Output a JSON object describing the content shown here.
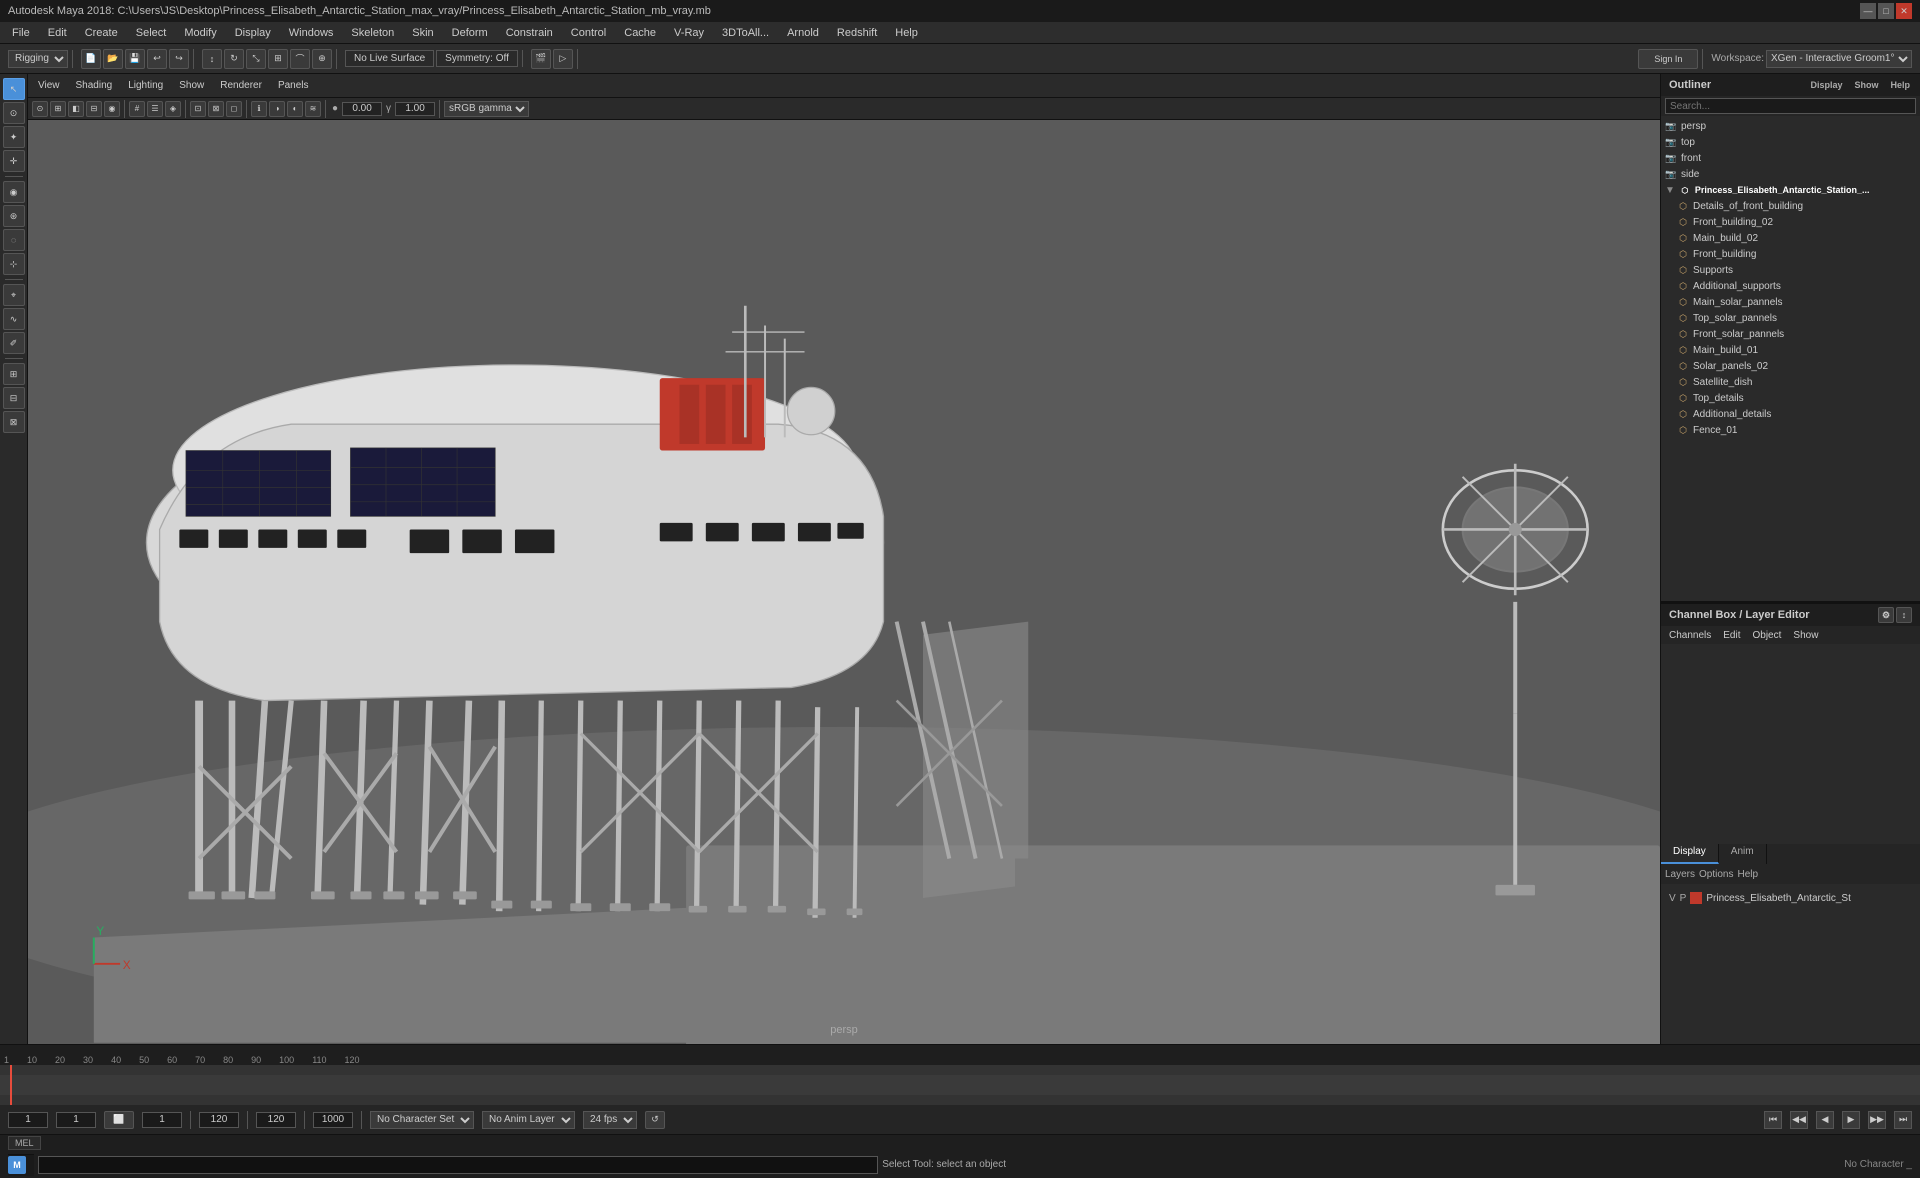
{
  "titlebar": {
    "title": "Autodesk Maya 2018: C:\\Users\\JS\\Desktop\\Princess_Elisabeth_Antarctic_Station_max_vray/Princess_Elisabeth_Antarctic_Station_mb_vray.mb",
    "controls": [
      "—",
      "□",
      "✕"
    ]
  },
  "menubar": {
    "items": [
      "File",
      "Edit",
      "Create",
      "Select",
      "Modify",
      "Display",
      "Windows",
      "Skeleton",
      "Skin",
      "Deform",
      "Constrain",
      "Control",
      "Cache",
      "V-Ray",
      "3DToAll...",
      "Arnold",
      "Redshift",
      "Help"
    ]
  },
  "toolbar": {
    "workspace_label": "Workspace:",
    "workspace_value": "XGen - Interactive Groom1°",
    "layout_dropdown": "Rigging",
    "no_live_surface": "No Live Surface",
    "symmetry": "Symmetry: Off",
    "sign_in": "Sign In"
  },
  "viewport": {
    "menus": [
      "View",
      "Shading",
      "Lighting",
      "Show",
      "Renderer",
      "Panels"
    ],
    "label": "persp",
    "gamma_label": "sRGB gamma",
    "gamma_value": "1.00",
    "color_value": "0.00"
  },
  "outliner": {
    "title": "Outliner",
    "menu_items": [
      "Display",
      "Show",
      "Help"
    ],
    "search_placeholder": "Search...",
    "items": [
      {
        "label": "persp",
        "type": "camera",
        "indent": 0
      },
      {
        "label": "top",
        "type": "camera",
        "indent": 0
      },
      {
        "label": "front",
        "type": "camera",
        "indent": 0
      },
      {
        "label": "side",
        "type": "camera",
        "indent": 0
      },
      {
        "label": "Princess_Elisabeth_Antarctic_Station_...",
        "type": "group",
        "indent": 0,
        "expanded": true
      },
      {
        "label": "Details_of_front_building",
        "type": "mesh",
        "indent": 1
      },
      {
        "label": "Front_building_02",
        "type": "mesh",
        "indent": 1
      },
      {
        "label": "Main_build_02",
        "type": "mesh",
        "indent": 1
      },
      {
        "label": "Front_building",
        "type": "mesh",
        "indent": 1
      },
      {
        "label": "Supports",
        "type": "mesh",
        "indent": 1
      },
      {
        "label": "Additional_supports",
        "type": "mesh",
        "indent": 1
      },
      {
        "label": "Main_solar_pannels",
        "type": "mesh",
        "indent": 1
      },
      {
        "label": "Top_solar_pannels",
        "type": "mesh",
        "indent": 1
      },
      {
        "label": "Front_solar_pannels",
        "type": "mesh",
        "indent": 1
      },
      {
        "label": "Main_build_01",
        "type": "mesh",
        "indent": 1
      },
      {
        "label": "Solar_panels_02",
        "type": "mesh",
        "indent": 1
      },
      {
        "label": "Satellite_dish",
        "type": "mesh",
        "indent": 1
      },
      {
        "label": "Top_details",
        "type": "mesh",
        "indent": 1
      },
      {
        "label": "Additional_details",
        "type": "mesh",
        "indent": 1
      },
      {
        "label": "Fence_01",
        "type": "mesh",
        "indent": 1
      }
    ]
  },
  "channel_box": {
    "title": "Channel Box / Layer Editor",
    "menu_items": [
      "Channels",
      "Edit",
      "Object",
      "Show"
    ]
  },
  "display_anim": {
    "tabs": [
      "Display",
      "Anim"
    ],
    "active_tab": "Display",
    "sub_items": [
      "Layers",
      "Options",
      "Help"
    ],
    "layer_name": "Princess_Elisabeth_Antarctic_St",
    "layer_color": "#c0392b"
  },
  "timeline": {
    "start": "1",
    "end": "120",
    "range_start": "1",
    "range_end": "120",
    "total_end": "1000",
    "fps": "24 fps",
    "ticks": [
      "1",
      "10",
      "20",
      "30",
      "40",
      "50",
      "60",
      "70",
      "80",
      "90",
      "100",
      "110",
      "120"
    ]
  },
  "bottom_controls": {
    "frame_start": "1",
    "frame_current": "1",
    "mel_label": "MEL",
    "no_character_set": "No Character Set",
    "no_anim_layer": "No Anim Layer",
    "fps": "24 fps"
  },
  "status_bar": {
    "message": "Select Tool: select an object"
  },
  "transport": {
    "buttons": [
      "⏮",
      "◀◀",
      "◀",
      "▶",
      "▶▶",
      "⏭",
      "⏹"
    ]
  },
  "maya_logo": "M"
}
